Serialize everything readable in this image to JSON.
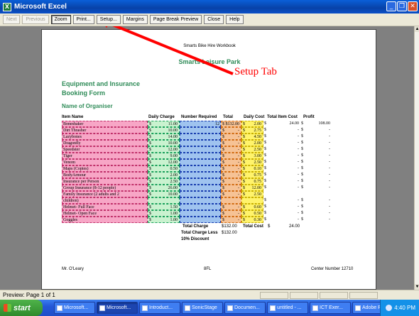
{
  "window": {
    "title": "Microsoft Excel",
    "app_icon": "X"
  },
  "toolbar": {
    "buttons": [
      {
        "label": "Next",
        "state": "disabled"
      },
      {
        "label": "Previous",
        "state": "disabled"
      },
      {
        "label": "Zoom",
        "state": "pressed"
      },
      {
        "label": "Print...",
        "state": "normal"
      },
      {
        "label": "Setup...",
        "state": "normal"
      },
      {
        "label": "Margins",
        "state": "normal"
      },
      {
        "label": "Page Break Preview",
        "state": "normal"
      },
      {
        "label": "Close",
        "state": "normal"
      },
      {
        "label": "Help",
        "state": "normal"
      }
    ]
  },
  "page": {
    "header": "Smarts Bike Hire Workbook",
    "park_title": "Smarts Leisure Park",
    "form_title_line1": "Equipment and Insurance",
    "form_title_line2": "Booking Form",
    "organiser_label": "Name of Organiser",
    "columns": [
      "Item Name",
      "Daily Charge",
      "Number Required",
      "Total",
      "Daily Cost",
      "Total Item Cost",
      "Profit"
    ],
    "rows": [
      {
        "item": "Boneshaker",
        "daily": "11.00",
        "req": "12",
        "total": "$132.00",
        "dcost": "2.00",
        "tic": "24.00",
        "profit": "108.00"
      },
      {
        "item": "Dirt Thrasher",
        "daily": "10.00",
        "req": "",
        "total": "-",
        "dcost": "2.75",
        "tic": "-",
        "profit": "-"
      },
      {
        "item": "Lazybones",
        "daily": "14.00",
        "req": "",
        "total": "-",
        "dcost": "4.50",
        "tic": "-",
        "profit": "-"
      },
      {
        "item": "Dragonfly",
        "daily": "10.00",
        "req": "",
        "total": "-",
        "dcost": "2.00",
        "tic": "-",
        "profit": "-"
      },
      {
        "item": "Speedster",
        "daily": "12.00",
        "req": "",
        "total": "-",
        "dcost": "2.50",
        "tic": "-",
        "profit": "-"
      },
      {
        "item": "Tiger",
        "daily": "9.00",
        "req": "",
        "total": "-",
        "dcost": "3.00",
        "tic": "-",
        "profit": "-"
      },
      {
        "item": "Venom",
        "daily": "12.00",
        "req": "",
        "total": "-",
        "dcost": "2.50",
        "tic": "-",
        "profit": "-"
      },
      {
        "item": "Maps (Copies)",
        "daily": "0.50",
        "req": "",
        "total": "-",
        "dcost": "0.10",
        "tic": "-",
        "profit": "-"
      },
      {
        "item": "BodyArmour",
        "daily": "2.00",
        "req": "",
        "total": "-",
        "dcost": "0.75",
        "tic": "-",
        "profit": "-"
      },
      {
        "item": "Insurance per Person",
        "daily": "2.50",
        "req": "",
        "total": "-",
        "dcost": "0.75",
        "tic": "-",
        "profit": "-"
      },
      {
        "item": "Group Insurance (8-12 people)",
        "daily": "26.00",
        "req": "",
        "total": "-",
        "dcost": "12.00",
        "tic": "-",
        "profit": "-"
      },
      {
        "item": "Family Insurance (2 adults and 2",
        "daily": "10.00",
        "req": "",
        "total": "-",
        "dcost": "2.50",
        "tic": "",
        "profit": ""
      },
      {
        "item": "children)",
        "daily": "",
        "req": "",
        "total": "",
        "dcost": "",
        "tic": "-",
        "profit": "-"
      },
      {
        "item": "Helmet- Full Face",
        "daily": "1.50",
        "req": "",
        "total": "-",
        "dcost": "0.60",
        "tic": "-",
        "profit": "-"
      },
      {
        "item": "Helmet- Open Face",
        "daily": "1.00",
        "req": "",
        "total": "-",
        "dcost": "0.50",
        "tic": "-",
        "profit": "-"
      },
      {
        "item": "Goggles",
        "daily": "1.00",
        "req": "",
        "total": "-",
        "dcost": "0.30",
        "tic": "-",
        "profit": "-"
      }
    ],
    "totals": {
      "total_charge_label": "Total Charge",
      "total_charge_value": "$132.00",
      "total_cost_label": "Total Cost",
      "total_cost_dollar": "$",
      "total_cost_value": "24.00",
      "less_label_line1": "Total Charge Less",
      "less_label_line2": "10% Discount",
      "less_value": "$132.00"
    },
    "footer_left": "Mr. O'Leary",
    "footer_mid": "8FL",
    "footer_right": "Center Number 12710"
  },
  "annotation": {
    "text": "Setup Tab",
    "color": "#ff0000"
  },
  "status_bar": {
    "text": "Preview: Page 1 of 1"
  },
  "taskbar": {
    "start_label": "start",
    "tasks": [
      {
        "label": "Microsoft...",
        "icon": "internet-explorer-icon",
        "active": false
      },
      {
        "label": "Microsoft...",
        "icon": "excel-icon",
        "active": true
      },
      {
        "label": "Introduct...",
        "icon": "word-icon",
        "active": false
      },
      {
        "label": "SonicStage",
        "icon": "sonicstage-icon",
        "active": false
      },
      {
        "label": "Documen...",
        "icon": "word-icon",
        "active": false
      },
      {
        "label": "untitled - ...",
        "icon": "paint-icon",
        "active": false
      },
      {
        "label": "ICT Exer...",
        "icon": "folder-icon",
        "active": false
      },
      {
        "label": "Adobe R...",
        "icon": "adobe-icon",
        "active": false
      }
    ],
    "clock": "4:40 PM"
  }
}
